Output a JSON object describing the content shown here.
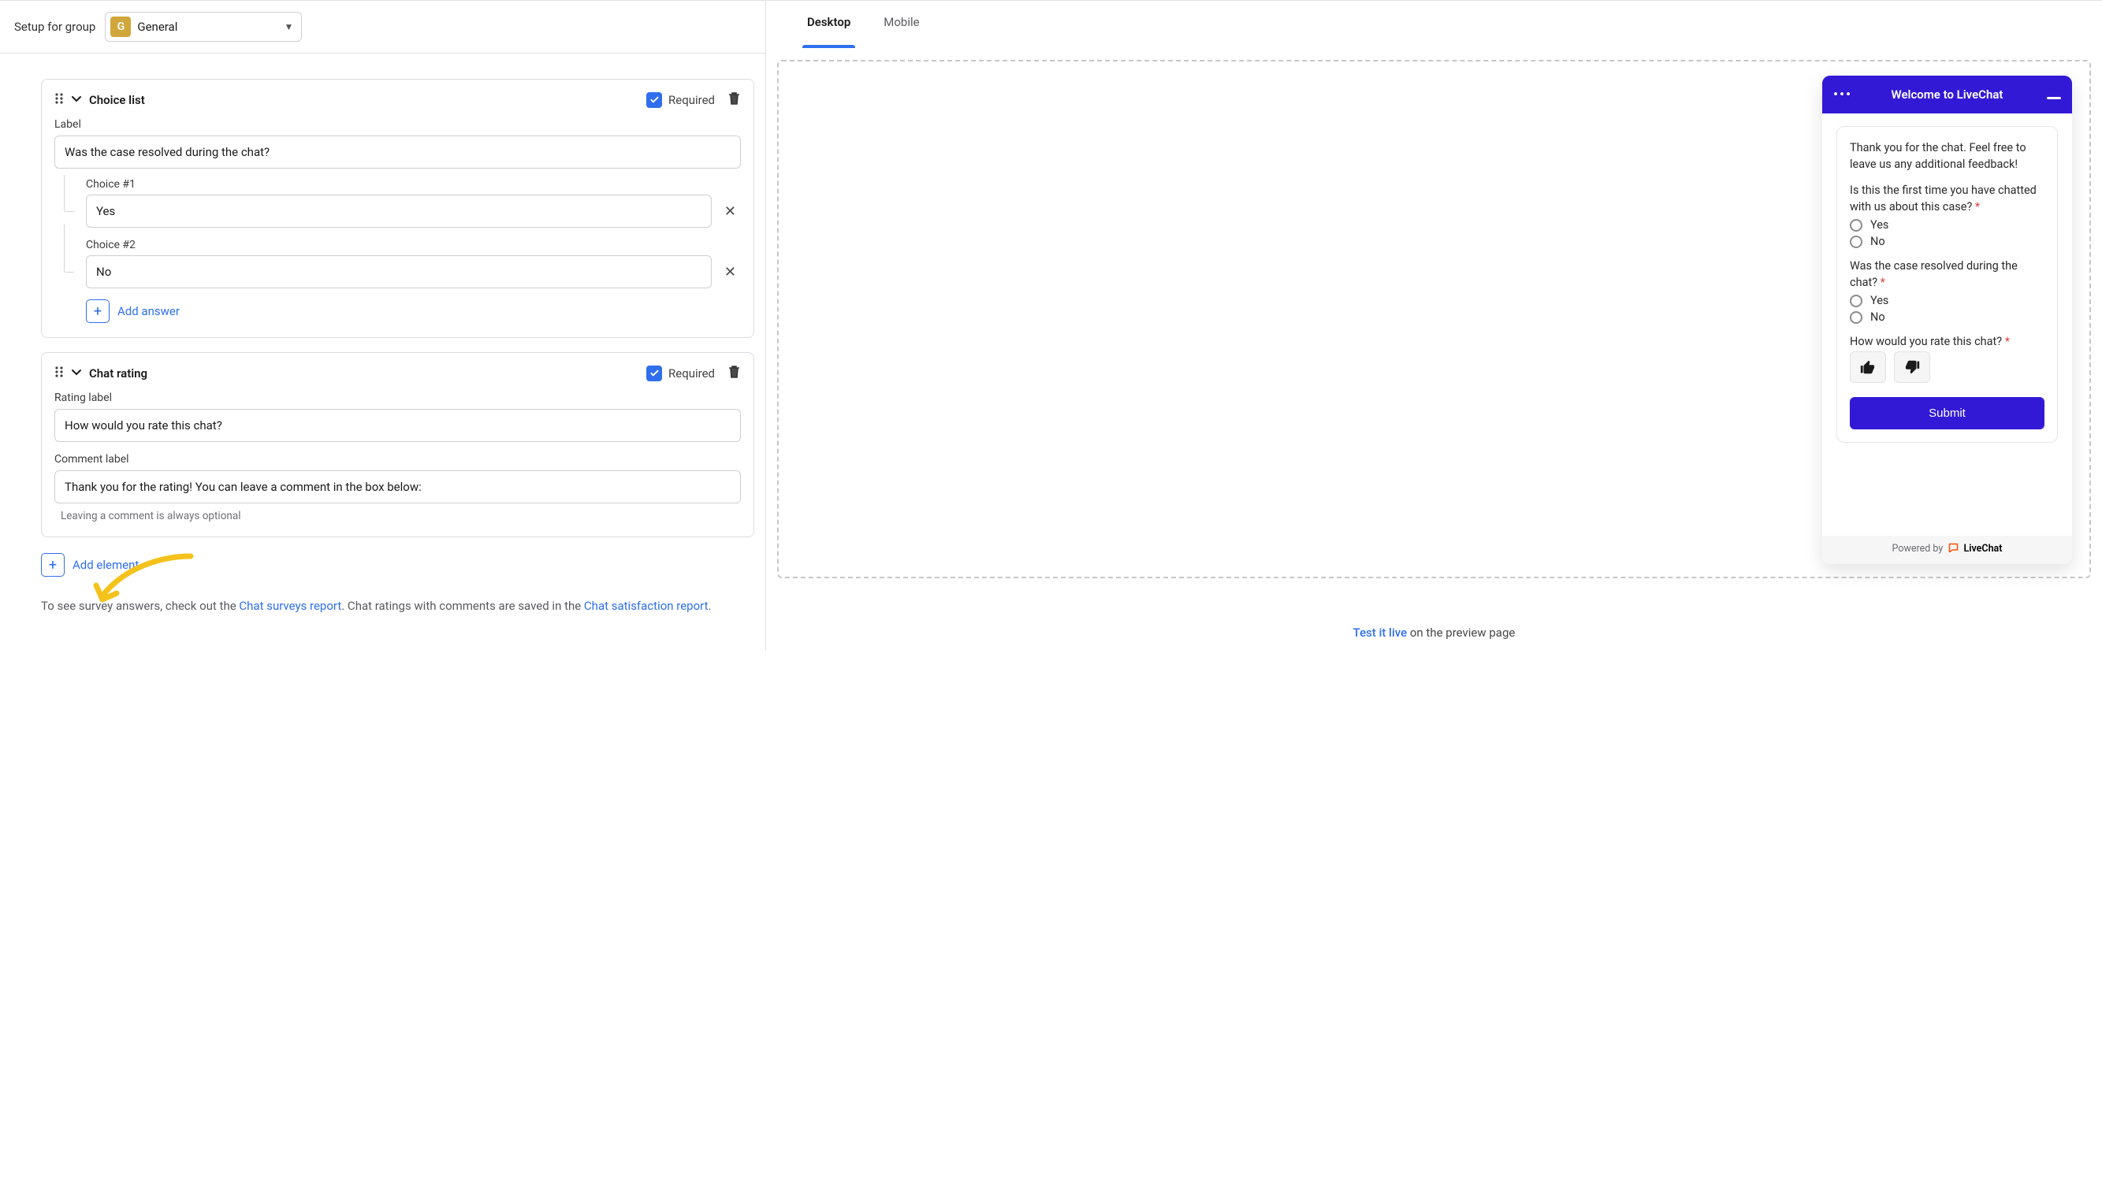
{
  "setup": {
    "label": "Setup for group",
    "group_avatar_letter": "G",
    "group_name": "General"
  },
  "card_choice": {
    "title": "Choice list",
    "required_label": "Required",
    "label_text": "Label",
    "question_value": "Was the case resolved during the chat?",
    "choice1_label": "Choice #1",
    "choice1_value": "Yes",
    "choice2_label": "Choice #2",
    "choice2_value": "No",
    "add_answer_label": "Add answer"
  },
  "card_rating": {
    "title": "Chat rating",
    "required_label": "Required",
    "rating_label_text": "Rating label",
    "rating_value": "How would you rate this chat?",
    "comment_label_text": "Comment label",
    "comment_value": "Thank you for the rating! You can leave a comment in the box below:",
    "optional_note": "Leaving a comment is always optional"
  },
  "add_element_label": "Add element",
  "footer": {
    "prefix": "To see survey answers, check out the ",
    "link1": "Chat surveys report",
    "middle": ". Chat ratings with comments are saved in the ",
    "link2": "Chat satisfaction report",
    "suffix": "."
  },
  "preview": {
    "tab_desktop": "Desktop",
    "tab_mobile": "Mobile",
    "widget_title": "Welcome to LiveChat",
    "intro_text": "Thank you for the chat. Feel free to leave us any additional feedback!",
    "q1": "Is this the first time you have chatted with us about this case?",
    "q2": "Was the case resolved during the chat?",
    "q3": "How would you rate this chat?",
    "opt_yes": "Yes",
    "opt_no": "No",
    "submit": "Submit",
    "powered_prefix": "Powered by",
    "powered_brand": "LiveChat",
    "footer_link": "Test it live",
    "footer_suffix": " on the preview page"
  }
}
